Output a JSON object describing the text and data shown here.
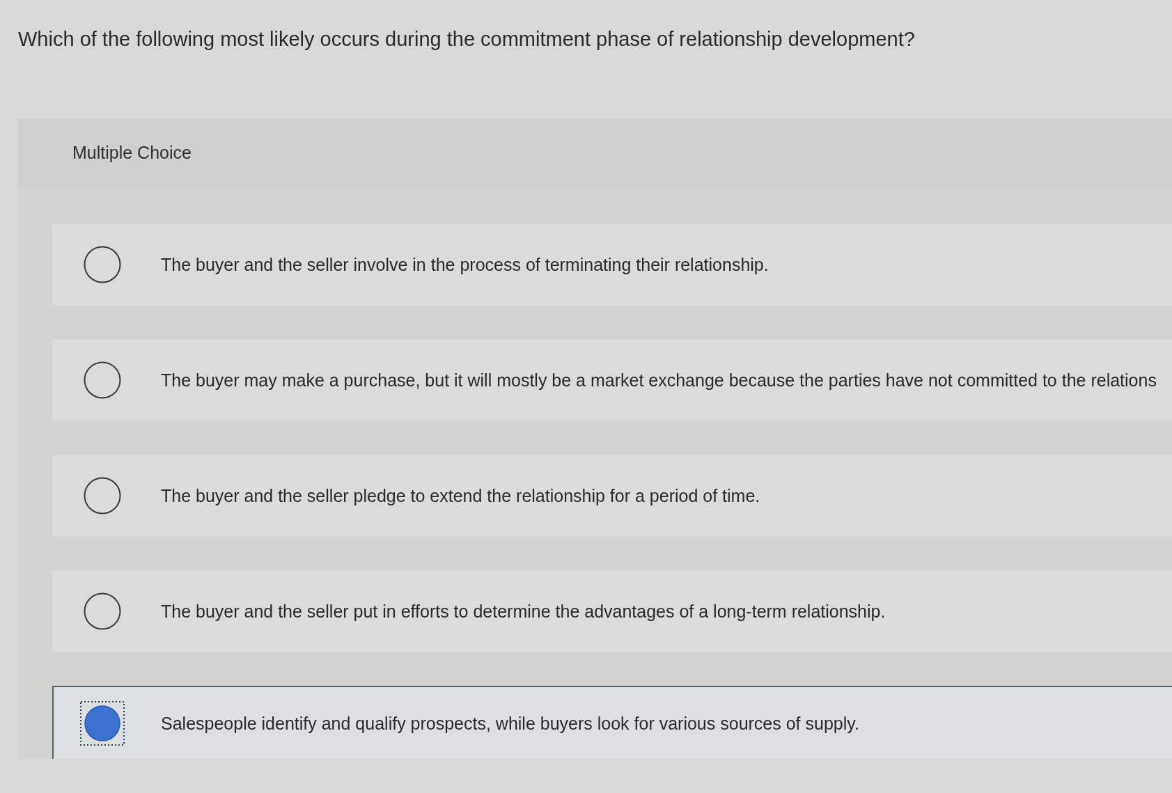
{
  "question": "Which of the following most likely occurs during the commitment phase of relationship development?",
  "answer_panel": {
    "heading": "Multiple Choice",
    "options": [
      {
        "text": "The buyer and the seller involve in the process of terminating their relationship.",
        "selected": false
      },
      {
        "text": "The buyer may make a purchase, but it will mostly be a market exchange because the parties have not committed to the relations",
        "selected": false
      },
      {
        "text": "The buyer and the seller pledge to extend the relationship for a period of time.",
        "selected": false
      },
      {
        "text": "The buyer and the seller put in efforts to determine the advantages of a long-term relationship.",
        "selected": false
      },
      {
        "text": "Salespeople identify and qualify prospects, while buyers look for various sources of supply.",
        "selected": true
      }
    ]
  }
}
